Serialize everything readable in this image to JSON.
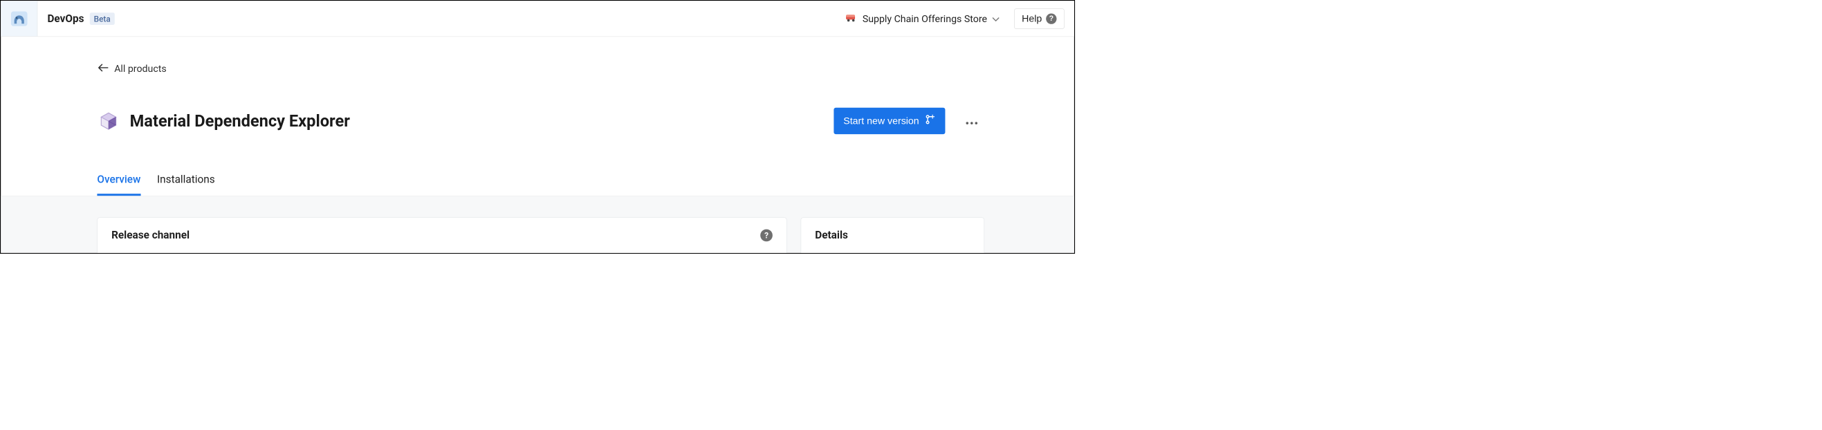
{
  "header": {
    "brand": "DevOps",
    "beta_badge": "Beta",
    "store": {
      "label": "Supply Chain Offerings Store"
    },
    "help_label": "Help"
  },
  "nav": {
    "back_label": "All products"
  },
  "page": {
    "title": "Material Dependency Explorer"
  },
  "actions": {
    "primary_label": "Start new version"
  },
  "tabs": [
    {
      "label": "Overview",
      "active": true
    },
    {
      "label": "Installations",
      "active": false
    }
  ],
  "cards": {
    "release_channel": {
      "title": "Release channel"
    },
    "details": {
      "title": "Details"
    }
  }
}
